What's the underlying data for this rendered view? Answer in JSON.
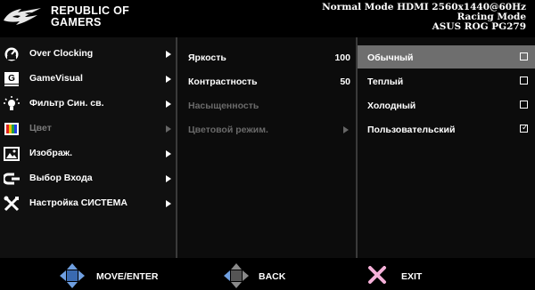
{
  "brand": {
    "line1": "REPUBLIC OF",
    "line2": "GAMERS"
  },
  "status": {
    "line1": "Normal Mode HDMI 2560x1440@60Hz",
    "line2": "Racing Mode",
    "line3": "ASUS ROG PG279"
  },
  "main_menu": [
    {
      "label": "Over Clocking",
      "icon": "speedometer-icon",
      "enabled": true
    },
    {
      "label": "GameVisual",
      "icon": "gamevisual-icon",
      "enabled": true
    },
    {
      "label": "Фильтр Син. св.",
      "icon": "blue-light-icon",
      "enabled": true
    },
    {
      "label": "Цвет",
      "icon": "color-icon",
      "enabled": false
    },
    {
      "label": "Изображ.",
      "icon": "image-icon",
      "enabled": true
    },
    {
      "label": "Выбор Входа",
      "icon": "input-icon",
      "enabled": true
    },
    {
      "label": "Настройка СИСТЕМА",
      "icon": "tools-icon",
      "enabled": true
    }
  ],
  "submenu": [
    {
      "label": "Яркость",
      "value": "100",
      "enabled": true
    },
    {
      "label": "Контрастность",
      "value": "50",
      "enabled": true
    },
    {
      "label": "Насыщенность",
      "value": "",
      "enabled": false
    },
    {
      "label": "Цветовой режим.",
      "value": "",
      "enabled": false
    }
  ],
  "options": [
    {
      "label": "Обычный",
      "checked": false,
      "selected": true
    },
    {
      "label": "Теплый",
      "checked": false,
      "selected": false
    },
    {
      "label": "Холодный",
      "checked": false,
      "selected": false
    },
    {
      "label": "Пользовательский",
      "checked": true,
      "selected": false
    }
  ],
  "footer": {
    "move_label": "MOVE/ENTER",
    "back_label": "BACK",
    "exit_label": "EXIT"
  },
  "colors": {
    "move_dpad": "#6f9fe0",
    "back_dpad": "#8a8a8a",
    "exit_x": "#f4b0d8",
    "selected_row": "#6e6e6e"
  }
}
